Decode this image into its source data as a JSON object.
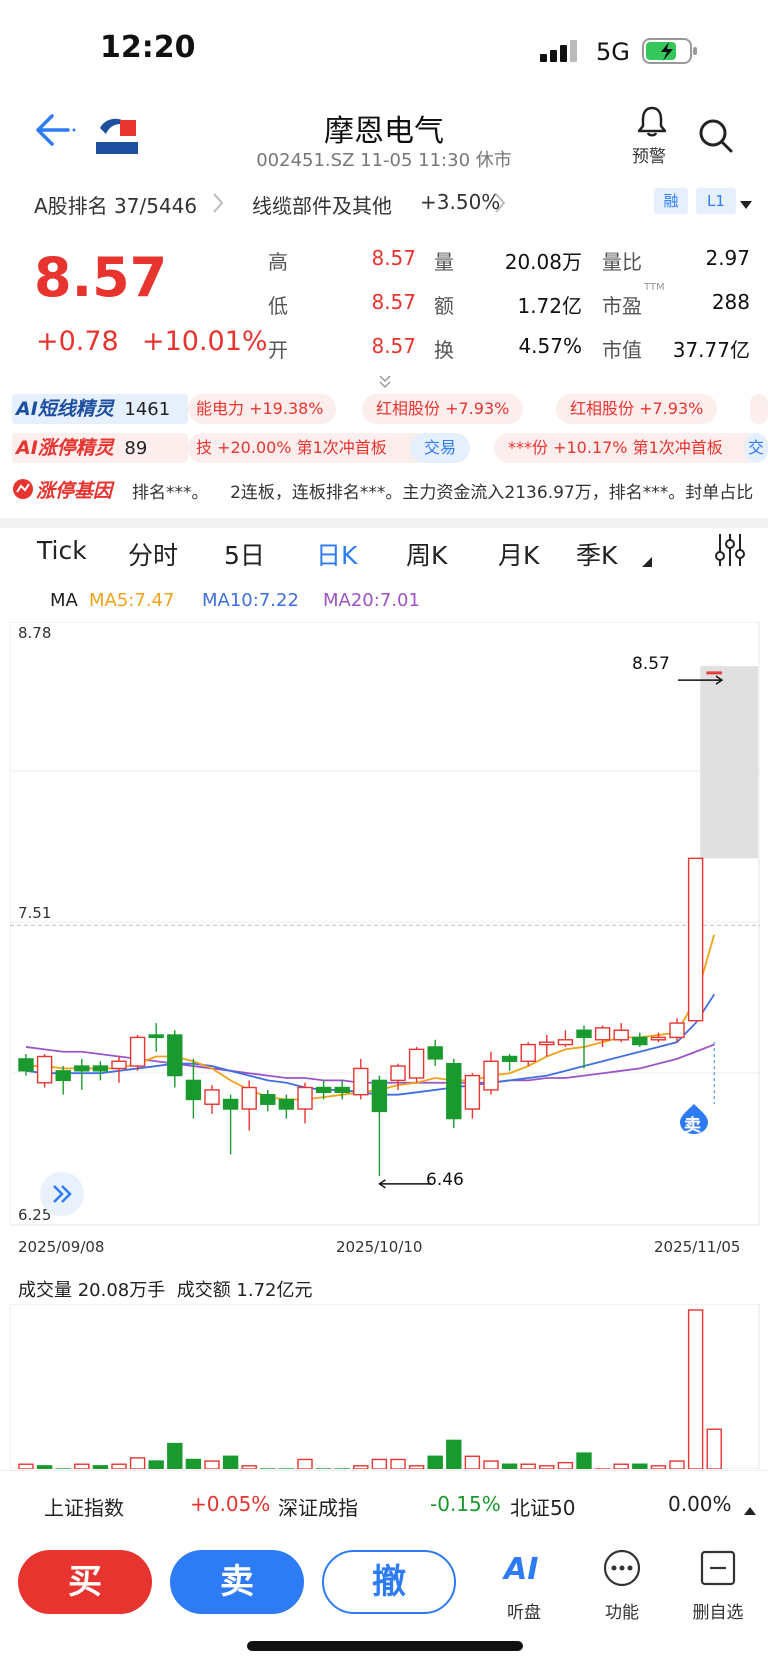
{
  "status": {
    "time": "12:20",
    "network": "5G"
  },
  "header": {
    "title": "摩恩电气",
    "subtitle": "002451.SZ 11-05 11:30 休市",
    "alarm_label": "预警"
  },
  "rank": {
    "a_share_rank": "A股排名 37/5446",
    "sector": "线缆部件及其他",
    "sector_change": "+3.50%",
    "badge_margin": "融",
    "badge_level": "L1"
  },
  "quote": {
    "price": "8.57",
    "change": "+0.78",
    "change_pct": "+10.01%",
    "fields": [
      {
        "label": "高",
        "value": "8.57"
      },
      {
        "label": "量",
        "value": "20.08万"
      },
      {
        "label": "量比",
        "value": "2.97"
      },
      {
        "label": "低",
        "value": "8.57"
      },
      {
        "label": "额",
        "value": "1.72亿"
      },
      {
        "label": "市盈",
        "sup": "TTM",
        "value": "288"
      },
      {
        "label": "开",
        "value": "8.57"
      },
      {
        "label": "换",
        "value": "4.57%"
      },
      {
        "label": "市值",
        "value": "37.77亿"
      }
    ]
  },
  "ai": {
    "short_label": "AI短线精灵",
    "short_count": "1461",
    "short_pills": [
      "能电力 +19.38%",
      "红相股份 +7.93%",
      "红相股份 +7.93%"
    ],
    "limit_label": "AI涨停精灵",
    "limit_count": "89",
    "limit_text_1": "技 +20.00% 第1次冲首板",
    "limit_trade": "交易",
    "limit_text_2": "***份 +10.17% 第1次冲首板",
    "limit_trade_2": "交",
    "gene_label": "涨停基因",
    "gene_text": "排名***。    2连板，连板排名***。主力资金流入2136.97万，排名***。封单占比"
  },
  "tabs": [
    "Tick",
    "分时",
    "5日",
    "日K",
    "周K",
    "月K",
    "季K"
  ],
  "active_tab": "日K",
  "ma": {
    "label": "MA",
    "ma5": "MA5:7.47",
    "ma10": "MA10:7.22",
    "ma20": "MA20:7.01",
    "colors": {
      "ma5": "#f0a318",
      "ma10": "#3f6fe0",
      "ma20": "#9b55c6"
    }
  },
  "chart_data": {
    "type": "candlestick",
    "y_max_label": "8.78",
    "y_mid_label": "7.51",
    "y_min_label": "6.25",
    "ylim": [
      6.25,
      8.78
    ],
    "x_labels": [
      "2025/09/08",
      "2025/10/10",
      "2025/11/05"
    ],
    "high_annotation": "8.57",
    "low_annotation": "6.46",
    "sell_marker": "卖",
    "candles": [
      {
        "o": 6.95,
        "c": 6.9,
        "h": 6.97,
        "l": 6.88
      },
      {
        "o": 6.85,
        "c": 6.96,
        "h": 6.97,
        "l": 6.83
      },
      {
        "o": 6.9,
        "c": 6.86,
        "h": 6.92,
        "l": 6.8
      },
      {
        "o": 6.92,
        "c": 6.9,
        "h": 6.95,
        "l": 6.82
      },
      {
        "o": 6.92,
        "c": 6.9,
        "h": 6.94,
        "l": 6.86
      },
      {
        "o": 6.91,
        "c": 6.94,
        "h": 6.96,
        "l": 6.85
      },
      {
        "o": 6.92,
        "c": 7.04,
        "h": 7.05,
        "l": 6.9
      },
      {
        "o": 7.05,
        "c": 7.04,
        "h": 7.1,
        "l": 6.98
      },
      {
        "o": 7.05,
        "c": 6.88,
        "h": 7.07,
        "l": 6.83
      },
      {
        "o": 6.86,
        "c": 6.78,
        "h": 6.95,
        "l": 6.7
      },
      {
        "o": 6.76,
        "c": 6.82,
        "h": 6.84,
        "l": 6.72
      },
      {
        "o": 6.78,
        "c": 6.74,
        "h": 6.8,
        "l": 6.55
      },
      {
        "o": 6.74,
        "c": 6.83,
        "h": 6.86,
        "l": 6.65
      },
      {
        "o": 6.8,
        "c": 6.76,
        "h": 6.82,
        "l": 6.73
      },
      {
        "o": 6.78,
        "c": 6.74,
        "h": 6.8,
        "l": 6.7
      },
      {
        "o": 6.74,
        "c": 6.83,
        "h": 6.85,
        "l": 6.68
      },
      {
        "o": 6.83,
        "c": 6.81,
        "h": 6.86,
        "l": 6.78
      },
      {
        "o": 6.83,
        "c": 6.81,
        "h": 6.86,
        "l": 6.78
      },
      {
        "o": 6.8,
        "c": 6.91,
        "h": 6.95,
        "l": 6.78
      },
      {
        "o": 6.86,
        "c": 6.73,
        "h": 6.88,
        "l": 6.46
      },
      {
        "o": 6.86,
        "c": 6.92,
        "h": 6.93,
        "l": 6.82
      },
      {
        "o": 6.87,
        "c": 6.99,
        "h": 7.0,
        "l": 6.85
      },
      {
        "o": 7.0,
        "c": 6.95,
        "h": 7.03,
        "l": 6.92
      },
      {
        "o": 6.93,
        "c": 6.7,
        "h": 6.95,
        "l": 6.66
      },
      {
        "o": 6.74,
        "c": 6.88,
        "h": 6.89,
        "l": 6.7
      },
      {
        "o": 6.82,
        "c": 6.94,
        "h": 6.98,
        "l": 6.8
      },
      {
        "o": 6.96,
        "c": 6.94,
        "h": 6.97,
        "l": 6.9
      },
      {
        "o": 6.94,
        "c": 7.01,
        "h": 7.02,
        "l": 6.92
      },
      {
        "o": 7.01,
        "c": 7.02,
        "h": 7.05,
        "l": 6.96
      },
      {
        "o": 7.01,
        "c": 7.03,
        "h": 7.07,
        "l": 7.0
      },
      {
        "o": 7.07,
        "c": 7.04,
        "h": 7.09,
        "l": 6.91
      },
      {
        "o": 7.03,
        "c": 7.08,
        "h": 7.09,
        "l": 7.0
      },
      {
        "o": 7.03,
        "c": 7.07,
        "h": 7.1,
        "l": 7.02
      },
      {
        "o": 7.04,
        "c": 7.01,
        "h": 7.06,
        "l": 7.0
      },
      {
        "o": 7.03,
        "c": 7.04,
        "h": 7.06,
        "l": 7.02
      },
      {
        "o": 7.04,
        "c": 7.1,
        "h": 7.12,
        "l": 7.02
      },
      {
        "o": 7.11,
        "c": 7.79,
        "h": 7.79,
        "l": 7.11
      },
      {
        "o": 8.57,
        "c": 8.57,
        "h": 8.57,
        "l": 8.57
      }
    ],
    "ma5": [
      6.92,
      6.92,
      6.91,
      6.91,
      6.91,
      6.91,
      6.93,
      6.96,
      6.96,
      6.94,
      6.91,
      6.86,
      6.82,
      6.79,
      6.78,
      6.78,
      6.79,
      6.8,
      6.81,
      6.82,
      6.84,
      6.85,
      6.87,
      6.86,
      6.86,
      6.88,
      6.89,
      6.92,
      6.96,
      6.99,
      7.0,
      7.02,
      7.04,
      7.04,
      7.05,
      7.06,
      7.2,
      7.47
    ],
    "ma10": [
      6.9,
      6.89,
      6.89,
      6.89,
      6.89,
      6.9,
      6.91,
      6.92,
      6.93,
      6.93,
      6.92,
      6.9,
      6.88,
      6.86,
      6.85,
      6.83,
      6.82,
      6.82,
      6.81,
      6.8,
      6.8,
      6.81,
      6.82,
      6.83,
      6.84,
      6.85,
      6.86,
      6.87,
      6.88,
      6.9,
      6.92,
      6.94,
      6.96,
      6.98,
      7.0,
      7.02,
      7.1,
      7.22
    ],
    "ma20": [
      7.0,
      6.99,
      6.98,
      6.98,
      6.97,
      6.96,
      6.95,
      6.94,
      6.93,
      6.92,
      6.91,
      6.9,
      6.89,
      6.88,
      6.87,
      6.87,
      6.86,
      6.86,
      6.85,
      6.85,
      6.85,
      6.85,
      6.85,
      6.85,
      6.85,
      6.85,
      6.86,
      6.86,
      6.87,
      6.87,
      6.88,
      6.89,
      6.9,
      6.91,
      6.93,
      6.95,
      6.98,
      7.01
    ],
    "volume_title": "成交量 20.08万手  成交额 1.72亿元",
    "volume": [
      3,
      2,
      0,
      3,
      2,
      3,
      7,
      5,
      16,
      6,
      5,
      8,
      2,
      0,
      0,
      6,
      0,
      0,
      2,
      6,
      6,
      2,
      8,
      18,
      8,
      5,
      3,
      3,
      2,
      4,
      10,
      0,
      3,
      3,
      2,
      5,
      100,
      25
    ],
    "volume_up": [
      true,
      false,
      false,
      true,
      false,
      true,
      true,
      false,
      false,
      false,
      true,
      false,
      true,
      false,
      false,
      true,
      false,
      false,
      true,
      true,
      true,
      true,
      false,
      false,
      true,
      true,
      false,
      true,
      true,
      true,
      false,
      true,
      true,
      false,
      true,
      true,
      true,
      true
    ]
  },
  "indices": [
    {
      "name": "上证指数",
      "change": "+0.05%"
    },
    {
      "name": "深证成指",
      "change": "-0.15%"
    },
    {
      "name": "北证50",
      "change": "0.00%"
    }
  ],
  "actions": {
    "buy": "买",
    "sell": "卖",
    "cancel": "撤"
  },
  "bottom_icons": [
    {
      "label": "听盘",
      "glyph": "AI"
    },
    {
      "label": "功能"
    },
    {
      "label": "删自选"
    }
  ]
}
